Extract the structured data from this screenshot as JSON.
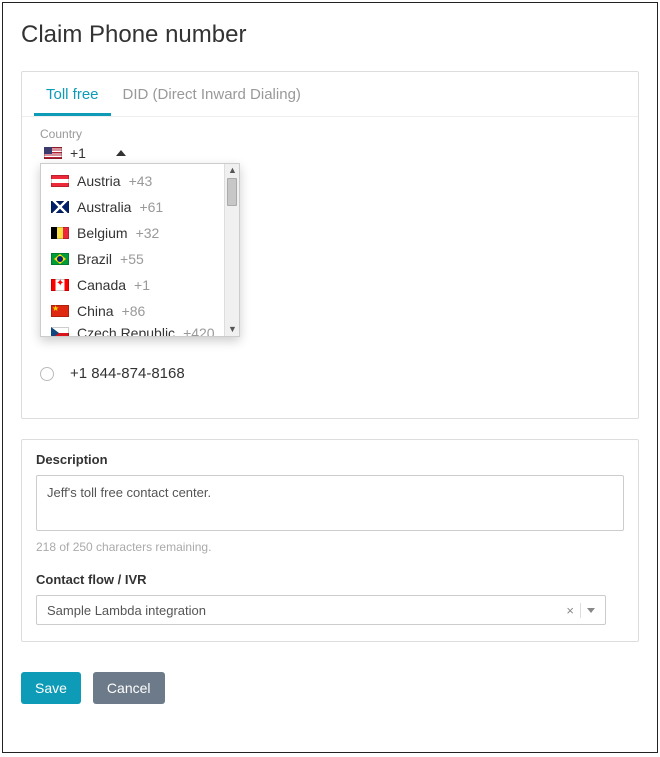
{
  "page_title": "Claim Phone number",
  "tabs": {
    "toll_free": "Toll free",
    "did": "DID (Direct Inward Dialing)"
  },
  "country": {
    "label": "Country",
    "selected_code": "+1",
    "options": [
      {
        "flag": "at",
        "name": "Austria",
        "code": "+43"
      },
      {
        "flag": "au",
        "name": "Australia",
        "code": "+61"
      },
      {
        "flag": "be",
        "name": "Belgium",
        "code": "+32"
      },
      {
        "flag": "br",
        "name": "Brazil",
        "code": "+55"
      },
      {
        "flag": "ca",
        "name": "Canada",
        "code": "+1"
      },
      {
        "flag": "cn",
        "name": "China",
        "code": "+86"
      },
      {
        "flag": "cz",
        "name": "Czech Republic",
        "code": "+420"
      }
    ]
  },
  "phone_numbers": [
    "+1 844-874-8168"
  ],
  "description": {
    "label": "Description",
    "value": "Jeff's toll free contact center.",
    "remaining_text": "218 of 250 characters remaining."
  },
  "contact_flow": {
    "label": "Contact flow / IVR",
    "value": "Sample Lambda integration"
  },
  "buttons": {
    "save": "Save",
    "cancel": "Cancel"
  }
}
